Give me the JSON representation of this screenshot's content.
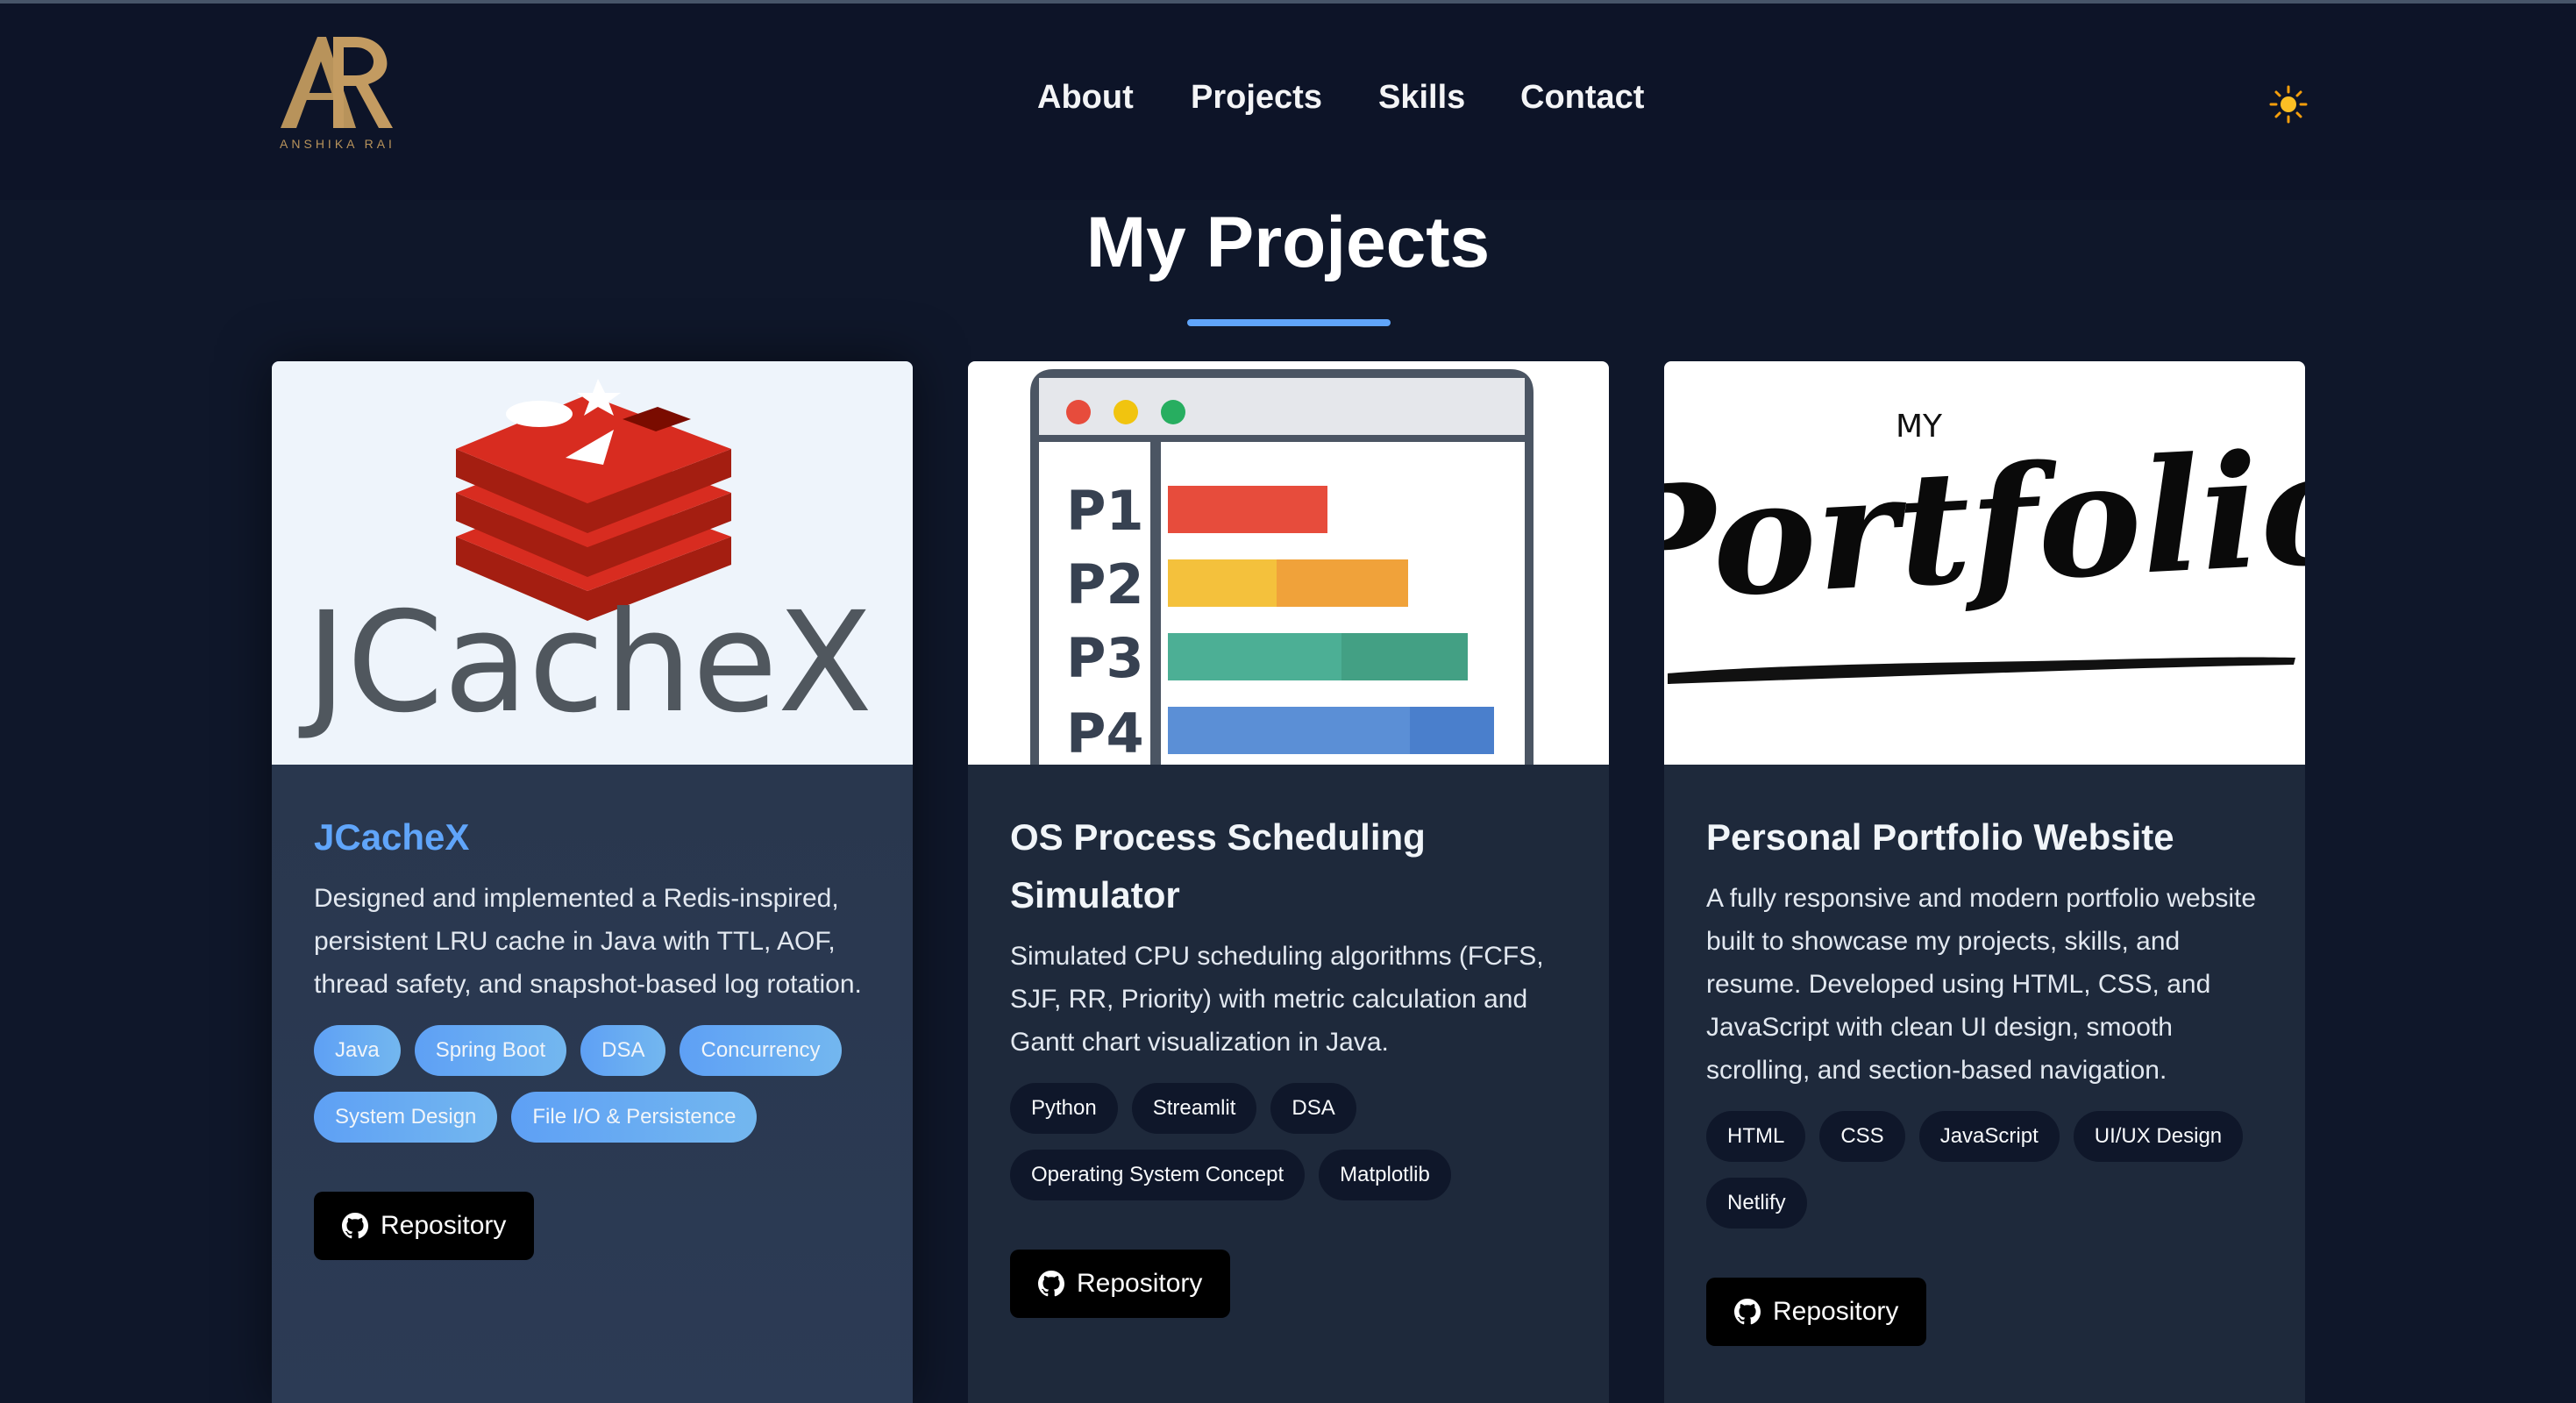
{
  "brand": {
    "logo_text": "ANSHIKA RAI",
    "gold": "#b8935b"
  },
  "nav": {
    "about": "About",
    "projects": "Projects",
    "skills": "Skills",
    "contact": "Contact"
  },
  "theme_toggle_icon": "sun-icon",
  "section": {
    "title": "My Projects"
  },
  "projects": [
    {
      "title": "JCacheX",
      "image_text": "JCacheX",
      "description": "Designed and implemented a Redis-inspired, persistent LRU cache in Java with TTL, AOF, thread safety, and snapshot-based log rotation.",
      "tags": [
        "Java",
        "Spring Boot",
        "DSA",
        "Concurrency",
        "System Design",
        "File I/O & Persistence"
      ],
      "repo_label": "Repository"
    },
    {
      "title": "OS Process Scheduling Simulator",
      "image_labels": [
        "P1",
        "P2",
        "P3",
        "P4"
      ],
      "description": "Simulated CPU scheduling algorithms (FCFS, SJF, RR, Priority) with metric calculation and Gantt chart visualization in Java.",
      "tags": [
        "Python",
        "Streamlit",
        "DSA",
        "Operating System Concept",
        "Matplotlib"
      ],
      "repo_label": "Repository"
    },
    {
      "title": "Personal Portfolio Website",
      "image_small": "MY",
      "image_script": "Portfolio",
      "description": "A fully responsive and modern portfolio website built to showcase my projects, skills, and resume. Developed using HTML, CSS, and JavaScript with clean UI design, smooth scrolling, and section-based navigation.",
      "tags": [
        "HTML",
        "CSS",
        "JavaScript",
        "UI/UX Design",
        "Netlify"
      ],
      "repo_label": "Repository"
    }
  ]
}
